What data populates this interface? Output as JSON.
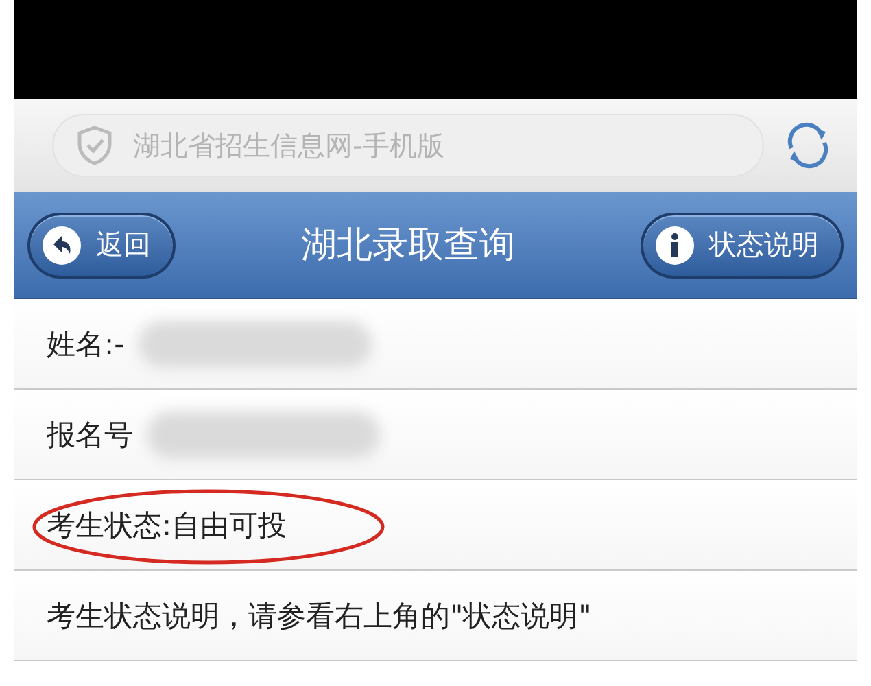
{
  "browser": {
    "address": "湖北省招生信息网-手机版"
  },
  "header": {
    "back_button": "返回",
    "title": "湖北录取查询",
    "info_button": "状态说明"
  },
  "rows": [
    {
      "label": "姓名:-",
      "redacted": true,
      "circled": false
    },
    {
      "label": "报名号",
      "redacted": true,
      "circled": false
    },
    {
      "label": "考生状态:自由可投",
      "redacted": false,
      "circled": true
    },
    {
      "label": "考生状态说明，请参看右上角的\"状态说明\"",
      "redacted": false,
      "circled": false
    }
  ]
}
